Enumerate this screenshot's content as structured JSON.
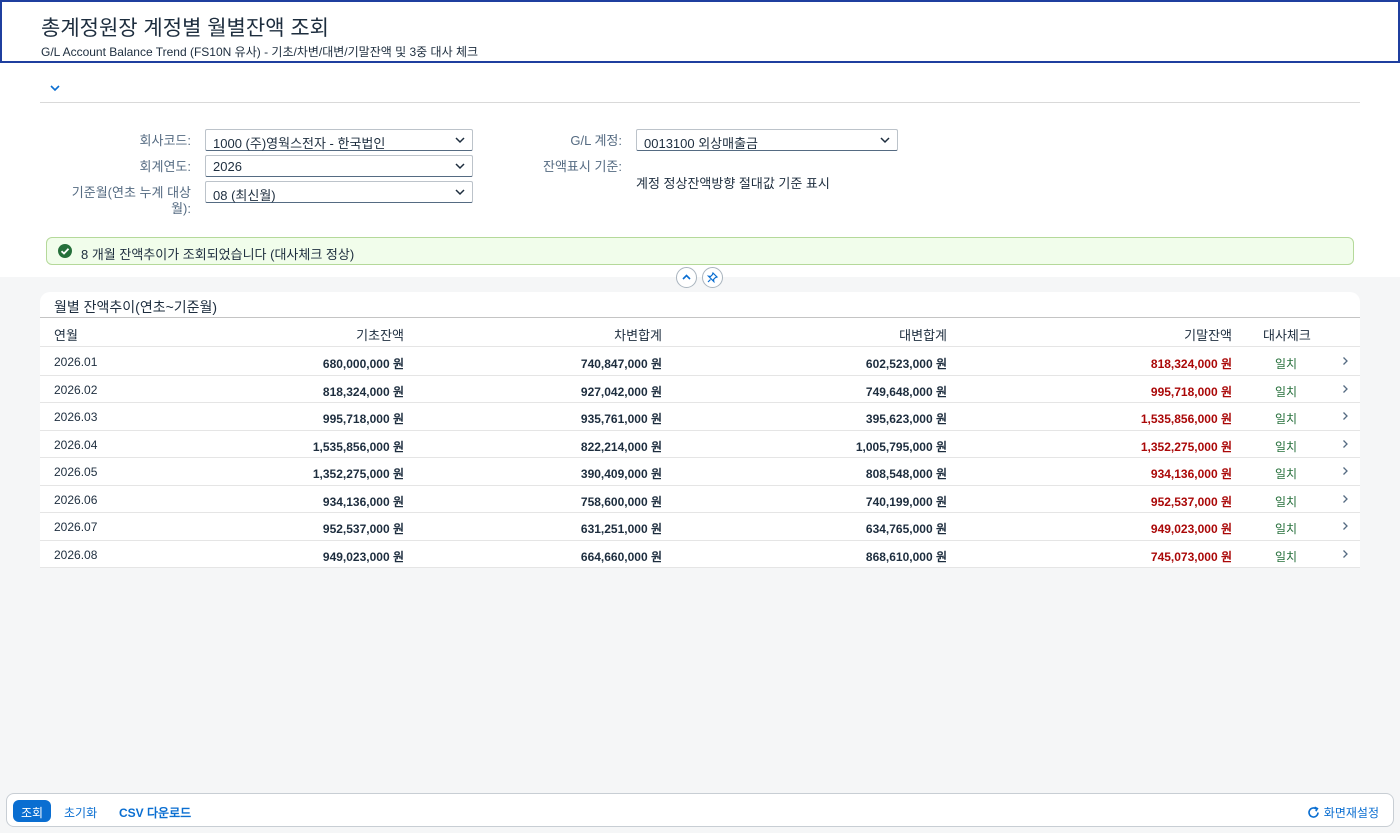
{
  "header": {
    "title": "총계정원장 계정별 월별잔액 조회",
    "subtitle": "G/L Account Balance Trend (FS10N 유사) - 기초/차변/대변/기말잔액 및 3중 대사 체크"
  },
  "filters": {
    "company_label": "회사코드:",
    "company_value": "1000 (주)영웍스전자 - 한국법인",
    "year_label": "회계연도:",
    "year_value": "2026",
    "month_label_line1": "기준월(연초 누계 대상",
    "month_label_line2": "월):",
    "month_value": "08 (최신월)",
    "gl_label": "G/L 계정:",
    "gl_value": "0013100 외상매출금",
    "display_label": "잔액표시 기준:",
    "display_value": "계정 정상잔액방향 절대값 기준 표시"
  },
  "message": "8 개월 잔액추이가 조회되었습니다 (대사체크 정상)",
  "table": {
    "title": "월별 잔액추이(연초~기준월)",
    "columns": [
      "연월",
      "기초잔액",
      "차변합계",
      "대변합계",
      "기말잔액",
      "대사체크"
    ],
    "rows": [
      {
        "period": "2026.01",
        "opening": "680,000,000 원",
        "debit": "740,847,000 원",
        "credit": "602,523,000 원",
        "closing": "818,324,000 원",
        "check": "일치"
      },
      {
        "period": "2026.02",
        "opening": "818,324,000 원",
        "debit": "927,042,000 원",
        "credit": "749,648,000 원",
        "closing": "995,718,000 원",
        "check": "일치"
      },
      {
        "period": "2026.03",
        "opening": "995,718,000 원",
        "debit": "935,761,000 원",
        "credit": "395,623,000 원",
        "closing": "1,535,856,000 원",
        "check": "일치"
      },
      {
        "period": "2026.04",
        "opening": "1,535,856,000 원",
        "debit": "822,214,000 원",
        "credit": "1,005,795,000 원",
        "closing": "1,352,275,000 원",
        "check": "일치"
      },
      {
        "period": "2026.05",
        "opening": "1,352,275,000 원",
        "debit": "390,409,000 원",
        "credit": "808,548,000 원",
        "closing": "934,136,000 원",
        "check": "일치"
      },
      {
        "period": "2026.06",
        "opening": "934,136,000 원",
        "debit": "758,600,000 원",
        "credit": "740,199,000 원",
        "closing": "952,537,000 원",
        "check": "일치"
      },
      {
        "period": "2026.07",
        "opening": "952,537,000 원",
        "debit": "631,251,000 원",
        "credit": "634,765,000 원",
        "closing": "949,023,000 원",
        "check": "일치"
      },
      {
        "period": "2026.08",
        "opening": "949,023,000 원",
        "debit": "664,660,000 원",
        "credit": "868,610,000 원",
        "closing": "745,073,000 원",
        "check": "일치"
      }
    ]
  },
  "footer": {
    "search": "조회",
    "reset": "초기화",
    "csv": "CSV 다운로드",
    "reset_screen": "화면재설정"
  },
  "colors": {
    "accent": "#0a6ed1",
    "header_border": "#1f3f9f",
    "closing_balance": "#aa0808",
    "check_ok": "#256f3a",
    "success_bg": "#f1fdeb"
  },
  "icons": {
    "collapse_toggle": "chevron-down-icon",
    "select_arrow": "chevron-down-icon",
    "success": "check-circle-icon",
    "collapse_header": "chevron-up-icon",
    "pin": "pin-icon",
    "row_nav": "chevron-right-icon",
    "refresh": "refresh-icon"
  }
}
